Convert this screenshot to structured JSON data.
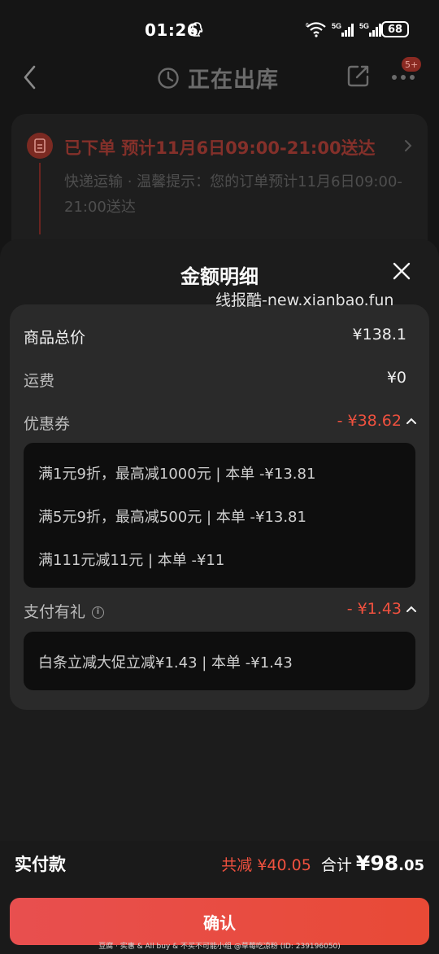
{
  "status_bar": {
    "time": "01:26",
    "battery": "68",
    "network_labels": [
      "6",
      "5G",
      "5G"
    ]
  },
  "nav": {
    "title": "正在出库",
    "badge": "5+",
    "icons": [
      "back-icon",
      "clock-icon",
      "share-icon",
      "more-icon"
    ]
  },
  "order": {
    "status": "已下单 预计11月6日09:00-21:00送达",
    "desc": "快递运输 · 温馨提示：您的订单预计11月6日09:00-21:00送达"
  },
  "sheet": {
    "title": "金额明细",
    "watermark": "线报酷-new.xianbao.fun",
    "rows": {
      "goods_total": {
        "label": "商品总价",
        "value": "¥138.1"
      },
      "shipping": {
        "label": "运费",
        "value": "¥0"
      },
      "coupon": {
        "label": "优惠券",
        "value": "- ¥38.62",
        "items": [
          "满1元9折，最高减1000元 | 本单 -¥13.81",
          "满5元9折，最高减500元 | 本单 -¥13.81",
          "满111元减11元 | 本单 -¥11"
        ]
      },
      "pay_gift": {
        "label": "支付有礼",
        "value": "- ¥1.43",
        "items": [
          "白条立减大促立减¥1.43 | 本单 -¥1.43"
        ]
      }
    }
  },
  "bottom": {
    "pay_label": "实付款",
    "discount": "共减 ¥40.05",
    "total_label": "合计",
    "total_int": "¥98",
    "total_dec": ".05",
    "confirm": "确认",
    "footer": "豆腐 · 实惠 & All buy & 不买不可能小组 @草莓吃凉粉 (ID: 239196050)"
  },
  "colors": {
    "accent_red": "#f0513f",
    "button_red": "#e84f4f",
    "background": "#151515"
  }
}
